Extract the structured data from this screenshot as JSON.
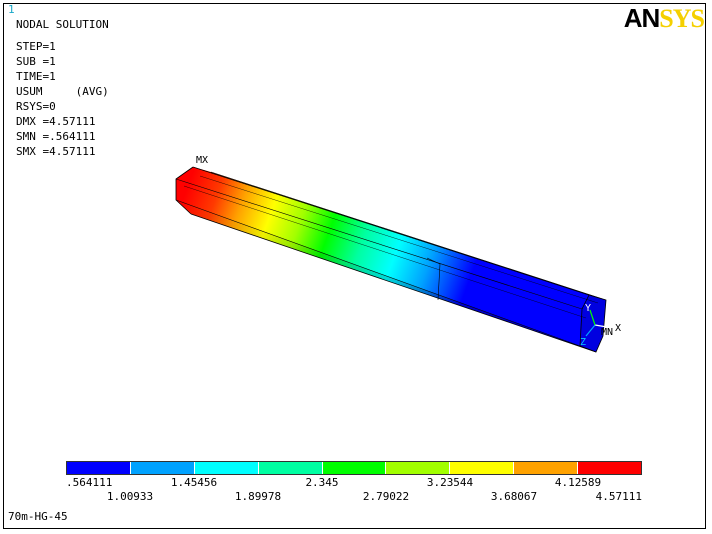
{
  "window_number": "1",
  "logo": {
    "part1": "AN",
    "part2": "SYS"
  },
  "solution": {
    "title": "NODAL SOLUTION",
    "lines": [
      "STEP=1",
      "SUB =1",
      "TIME=1",
      "USUM     (AVG)",
      "RSYS=0",
      "DMX =4.57111",
      "SMN =.564111",
      "SMX =4.57111"
    ]
  },
  "model": {
    "max_label": "MX",
    "min_label": "MN"
  },
  "triad": {
    "x": "X",
    "y": "Y",
    "z": "Z"
  },
  "contour": {
    "min": 0.564111,
    "max": 4.57111,
    "colors": [
      "#0000ff",
      "#00a2ff",
      "#00ffff",
      "#00ffa2",
      "#00ff00",
      "#a2ff00",
      "#ffff00",
      "#ffa200",
      "#ff0000"
    ],
    "labels_top": [
      ".564111",
      "1.45456",
      "2.345",
      "3.23544",
      "4.12589"
    ],
    "labels_bottom": [
      "1.00933",
      "1.89978",
      "2.79022",
      "3.68067",
      "4.57111"
    ]
  },
  "jobname": "70m-HG-45"
}
